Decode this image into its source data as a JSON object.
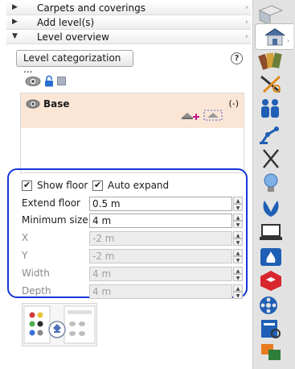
{
  "sections": [
    {
      "label": "Carpets and coverings",
      "state": "collapsed"
    },
    {
      "label": "Add level(s)",
      "state": "collapsed"
    },
    {
      "label": "Level overview",
      "state": "expanded"
    }
  ],
  "toolbar": {
    "categorization_label": "Level categorization ...",
    "help_label": "?"
  },
  "level": {
    "name": "Base",
    "toggle_label": "(-)"
  },
  "options": {
    "show_floor_label": "Show floor",
    "auto_expand_label": "Auto expand",
    "show_floor_checked": true,
    "auto_expand_checked": true
  },
  "fields": [
    {
      "label": "Extend floor",
      "value": "0.5 m",
      "enabled": true
    },
    {
      "label": "Minimum size",
      "value": "4 m",
      "enabled": true
    },
    {
      "label": "X",
      "value": "-2 m",
      "enabled": false
    },
    {
      "label": "Y",
      "value": "-2 m",
      "enabled": false
    },
    {
      "label": "Width",
      "value": "4 m",
      "enabled": false
    },
    {
      "label": "Depth",
      "value": "4 m",
      "enabled": false
    }
  ],
  "glyphs": {
    "collapsed": "▶",
    "expanded": "▼",
    "row_arrow": "›",
    "check": "✔",
    "spin_up": "▲",
    "spin_down": "▼"
  },
  "colors": {
    "highlight_border": "#1535d6",
    "level_bg": "#fbe6d6",
    "accent_magenta": "#c0168c"
  },
  "sidebar_icons": [
    "floor-icon",
    "house-icon",
    "materials-icon",
    "tools-icon",
    "people-icon",
    "robot-arm-icon",
    "utensils-icon",
    "lightbulb-icon",
    "plant-icon",
    "laptop-icon",
    "fireplace-icon",
    "sketchup-icon",
    "film-icon",
    "catalog-icon",
    "shapes-icon"
  ]
}
